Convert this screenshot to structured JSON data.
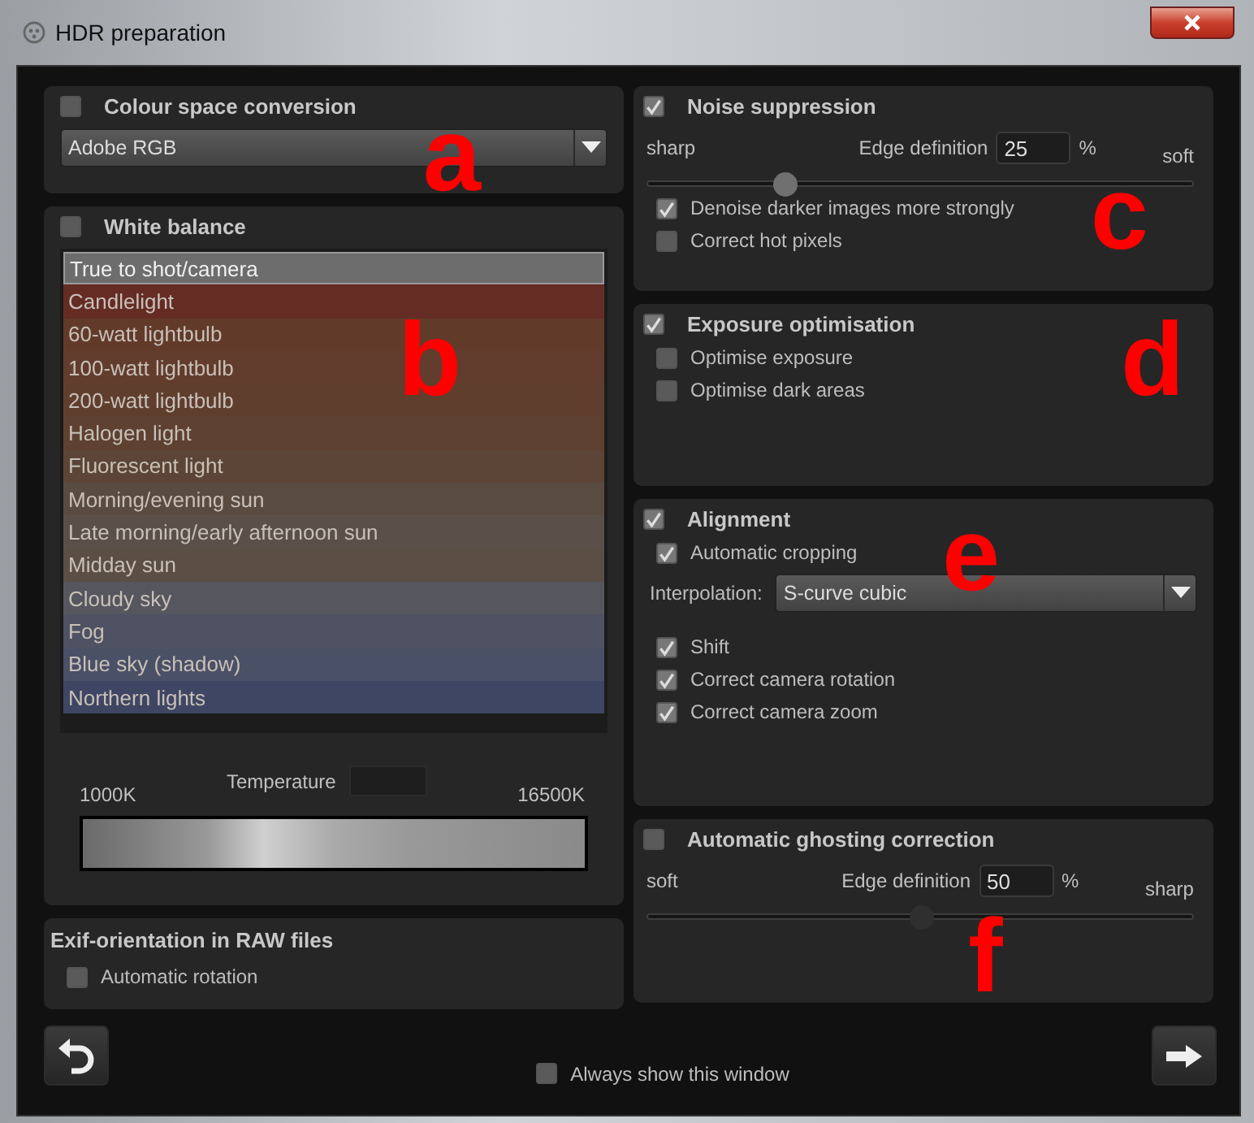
{
  "window": {
    "title": "HDR preparation"
  },
  "colour_space": {
    "title": "Colour space conversion",
    "checked": false,
    "dropdown": "Adobe RGB",
    "annotation": "a"
  },
  "white_balance": {
    "title": "White balance",
    "checked": false,
    "annotation": "b",
    "presets": [
      {
        "label": "True to shot/camera",
        "selected": true,
        "color": "#6d6d6d"
      },
      {
        "label": "Candlelight",
        "selected": false,
        "color": "#652c24"
      },
      {
        "label": "60-watt lightbulb",
        "selected": false,
        "color": "#623a2a"
      },
      {
        "label": "100-watt lightbulb",
        "selected": false,
        "color": "#623c2c"
      },
      {
        "label": "200-watt lightbulb",
        "selected": false,
        "color": "#603e2e"
      },
      {
        "label": "Halogen light",
        "selected": false,
        "color": "#5e4131"
      },
      {
        "label": "Fluorescent light",
        "selected": false,
        "color": "#5c4536"
      },
      {
        "label": "Morning/evening sun",
        "selected": false,
        "color": "#5a4b41"
      },
      {
        "label": "Late morning/early afternoon sun",
        "selected": false,
        "color": "#5b5049"
      },
      {
        "label": "Midday sun",
        "selected": false,
        "color": "#5b4e45"
      },
      {
        "label": "Cloudy sky",
        "selected": false,
        "color": "#55565e"
      },
      {
        "label": "Fog",
        "selected": false,
        "color": "#4f5262"
      },
      {
        "label": "Blue sky (shadow)",
        "selected": false,
        "color": "#4a5066"
      },
      {
        "label": "Northern lights",
        "selected": false,
        "color": "#3e4663"
      }
    ],
    "temperature": {
      "min": "1000K",
      "label": "Temperature",
      "max": "16500K"
    }
  },
  "exif": {
    "title": "Exif-orientation in RAW files",
    "options": [
      {
        "label": "Automatic rotation",
        "checked": false
      }
    ]
  },
  "noise": {
    "title": "Noise suppression",
    "checked": true,
    "annotation": "c",
    "slider": {
      "left": "sharp",
      "label": "Edge definition",
      "value": "25",
      "unit": "%",
      "right": "soft",
      "level": 0.25
    },
    "options": [
      {
        "label": "Denoise darker images more strongly",
        "checked": true
      },
      {
        "label": "Correct hot pixels",
        "checked": false
      }
    ]
  },
  "exposure": {
    "title": "Exposure optimisation",
    "checked": true,
    "annotation": "d",
    "options": [
      {
        "label": "Optimise exposure",
        "checked": false
      },
      {
        "label": "Optimise dark areas",
        "checked": false
      }
    ]
  },
  "alignment": {
    "title": "Alignment",
    "checked": true,
    "annotation": "e",
    "options_top": [
      {
        "label": "Automatic cropping",
        "checked": true
      }
    ],
    "interpolation": {
      "label": "Interpolation:",
      "value": "S-curve cubic"
    },
    "options": [
      {
        "label": "Shift",
        "checked": true
      },
      {
        "label": "Correct camera rotation",
        "checked": true
      },
      {
        "label": "Correct camera zoom",
        "checked": true
      }
    ]
  },
  "ghosting": {
    "title": "Automatic ghosting correction",
    "checked": false,
    "annotation": "f",
    "slider": {
      "left": "soft",
      "label": "Edge definition",
      "value": "50",
      "unit": "%",
      "right": "sharp",
      "level": 0.5
    }
  },
  "footer": {
    "always_show": {
      "label": "Always show this window",
      "checked": false
    }
  }
}
